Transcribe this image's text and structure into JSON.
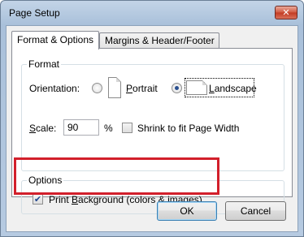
{
  "window": {
    "title": "Page Setup",
    "close_glyph": "✕"
  },
  "tabs": [
    {
      "label": "Format & Options",
      "active": true
    },
    {
      "label": "Margins & Header/Footer",
      "active": false
    }
  ],
  "format": {
    "group_label": "Format",
    "orientation_label": "Orientation:",
    "portrait_label": "Portrait",
    "landscape_label": "Landscape",
    "selected": "Landscape",
    "scale_label": "Scale:",
    "scale_value": "90",
    "percent": "%",
    "shrink_label": "Shrink to fit Page Width",
    "shrink_checked": false
  },
  "options": {
    "group_label": "Options",
    "print_background_label": "Print Background (colors & images)",
    "print_background_checked": true,
    "check_glyph": "✔"
  },
  "buttons": {
    "ok": "OK",
    "cancel": "Cancel"
  },
  "colors": {
    "highlight": "#d21f2b"
  }
}
